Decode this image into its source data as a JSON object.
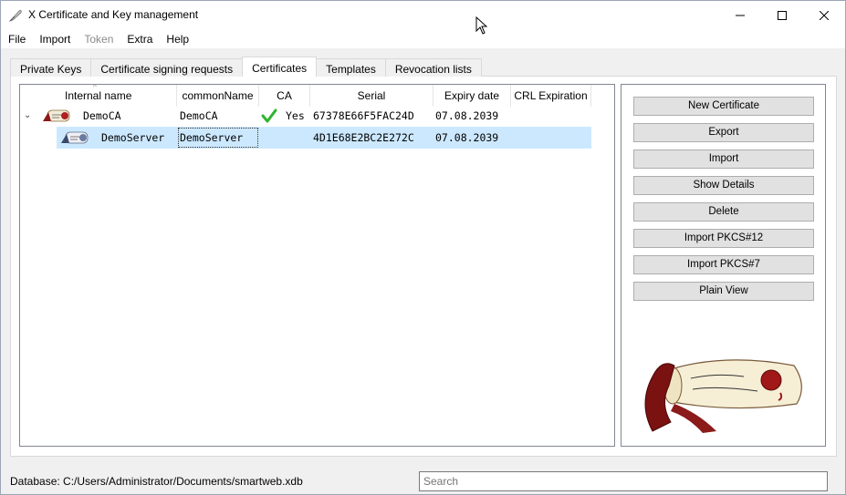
{
  "window": {
    "title": "X Certificate and Key management",
    "minimize": "—",
    "maximize": "☐",
    "close": "✕"
  },
  "menu": {
    "file": "File",
    "import": "Import",
    "token": "Token",
    "extra": "Extra",
    "help": "Help"
  },
  "tabs": {
    "private_keys": "Private Keys",
    "csr": "Certificate signing requests",
    "certificates": "Certificates",
    "templates": "Templates",
    "revocation": "Revocation lists"
  },
  "tree": {
    "columns": {
      "internal_name": "Internal name",
      "common_name": "commonName",
      "ca": "CA",
      "serial": "Serial",
      "expiry": "Expiry date",
      "crl": "CRL Expiration"
    },
    "rows": [
      {
        "internal_name": "DemoCA",
        "common_name": "DemoCA",
        "ca": "Yes",
        "serial": "67378E66F5FAC24D",
        "expiry": "07.08.2039",
        "expander": "⌄"
      },
      {
        "internal_name": "DemoServer",
        "common_name": "DemoServer",
        "ca": "",
        "serial": "4D1E68E2BC2E272C",
        "expiry": "07.08.2039"
      }
    ]
  },
  "buttons": {
    "new_certificate": "New Certificate",
    "export": "Export",
    "import": "Import",
    "show_details": "Show Details",
    "delete": "Delete",
    "import_pkcs12": "Import PKCS#12",
    "import_pkcs7": "Import PKCS#7",
    "plain_view": "Plain View"
  },
  "status": {
    "database": "Database: C:/Users/Administrator/Documents/smartweb.xdb"
  },
  "search": {
    "placeholder": "Search"
  },
  "colors": {
    "selection": "#cce8ff",
    "check": "#2db52d",
    "seal": "#8b1a1a"
  }
}
